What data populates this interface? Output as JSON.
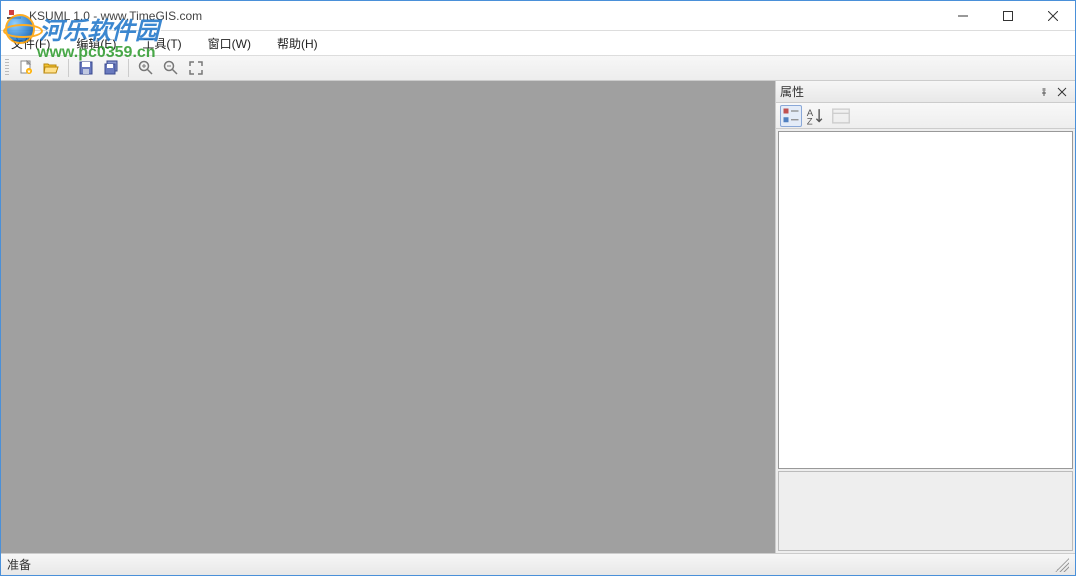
{
  "window": {
    "title": "KSUML 1.0 - www.TimeGIS.com"
  },
  "menu": {
    "file": "文件(F)",
    "edit": "编辑(E)",
    "tools": "工具(T)",
    "window": "窗口(W)",
    "help": "帮助(H)"
  },
  "toolbar": {
    "new": "new-file",
    "open": "open-folder",
    "save": "save",
    "saveall": "save-all",
    "zoomin": "zoom-in",
    "zoomout": "zoom-out",
    "fit": "fit-screen"
  },
  "properties": {
    "title": "属性",
    "sort_cat": "categorized",
    "sort_az": "alphabetical",
    "pages": "property-pages"
  },
  "statusbar": {
    "ready": "准备"
  },
  "watermark": {
    "name": "河乐软件园",
    "url": "www.pc0359.cn"
  }
}
